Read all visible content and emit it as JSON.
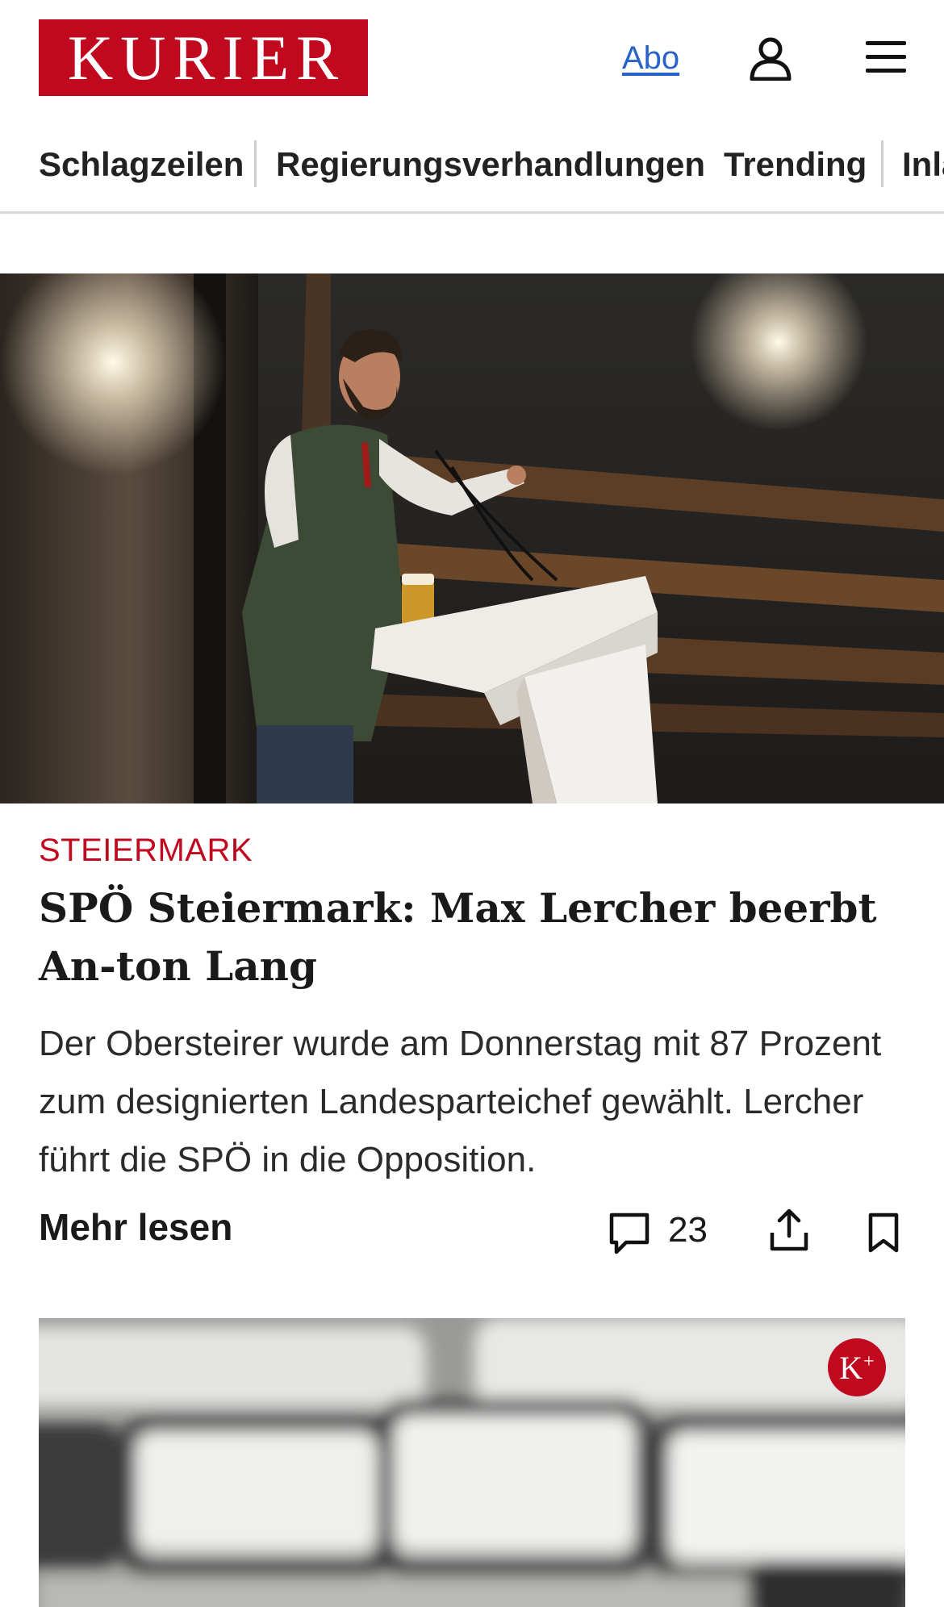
{
  "header": {
    "logo_text": "KURIER",
    "abo_label": "Abo",
    "icons": [
      "user-icon",
      "hamburger-menu-icon"
    ]
  },
  "nav": {
    "items": [
      "Schlagzeilen",
      "Regierungsverhandlungen",
      "Trending",
      "Inland"
    ]
  },
  "article": {
    "image_icon": "photo-man-at-lectern",
    "category": "STEIERMARK",
    "title": "SPÖ Steiermark: Max Lercher beerbt An-ton Lang",
    "teaser": "Der Obersteirer wurde am Donnerstag mit 87 Prozent zum designierten Landesparteichef gewählt. Lercher führt die SPÖ in die Opposition.",
    "more_label": "Mehr lesen",
    "comment_count": "23",
    "icons": [
      "comment-icon",
      "share-icon",
      "bookmark-icon"
    ]
  },
  "card2": {
    "image_icon": "photo-blurred-keyboard",
    "badge": "K",
    "badge_sup": "+"
  },
  "colors": {
    "brand_red": "#c0081f",
    "link_blue": "#2a62c9"
  }
}
